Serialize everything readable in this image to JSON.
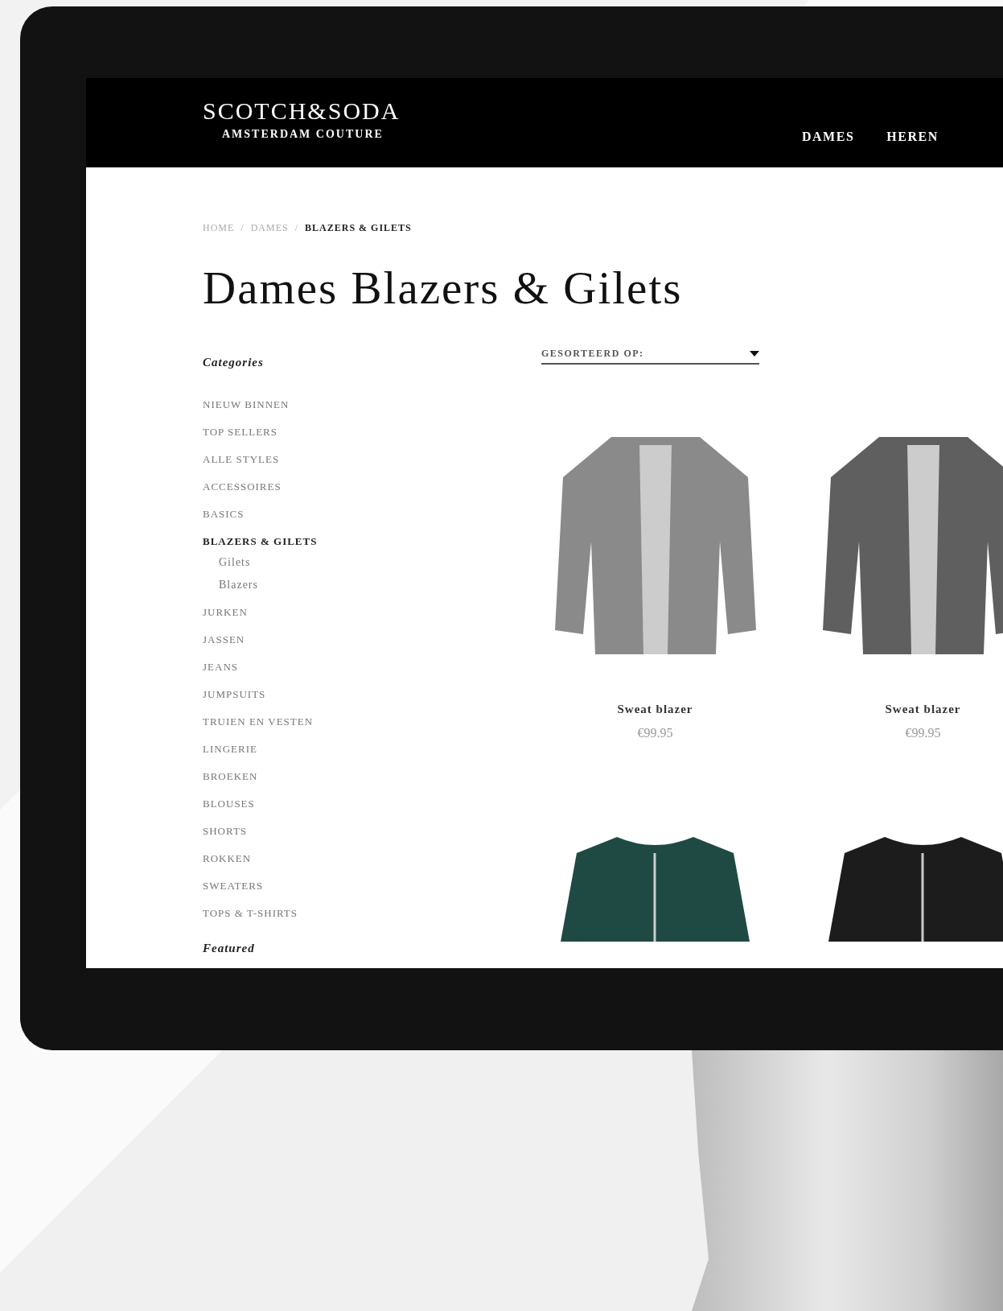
{
  "header": {
    "logo": "SCOTCH&SODA",
    "tagline": "AMSTERDAM COUTURE",
    "nav": [
      "DAMES",
      "HEREN"
    ]
  },
  "breadcrumb_separator": "/",
  "breadcrumb": [
    {
      "label": "HOME",
      "selected": false
    },
    {
      "label": "DAMES",
      "selected": false
    },
    {
      "label": "BLAZERS & GILETS",
      "selected": true
    }
  ],
  "title": "Dames Blazers & Gilets",
  "sidebar": {
    "heading": "Categories",
    "items": [
      {
        "label": "NIEUW BINNEN",
        "selected": false
      },
      {
        "label": "TOP SELLERS",
        "selected": false
      },
      {
        "label": "ALLE STYLES",
        "selected": false
      },
      {
        "label": "ACCESSOIRES",
        "selected": false
      },
      {
        "label": "BASICS",
        "selected": false
      },
      {
        "label": "BLAZERS & GILETS",
        "selected": true,
        "children": [
          {
            "label": "Gilets",
            "selected": false
          },
          {
            "label": "Blazers",
            "selected": false
          }
        ]
      },
      {
        "label": "JURKEN",
        "selected": false
      },
      {
        "label": "JASSEN",
        "selected": false
      },
      {
        "label": "JEANS",
        "selected": false
      },
      {
        "label": "JUMPSUITS",
        "selected": false
      },
      {
        "label": "TRUIEN EN VESTEN",
        "selected": false
      },
      {
        "label": "LINGERIE",
        "selected": false
      },
      {
        "label": "BROEKEN",
        "selected": false
      },
      {
        "label": "BLOUSES",
        "selected": false
      },
      {
        "label": "SHORTS",
        "selected": false
      },
      {
        "label": "ROKKEN",
        "selected": false
      },
      {
        "label": "SWEATERS",
        "selected": false
      },
      {
        "label": "TOPS & T-SHIRTS",
        "selected": false
      }
    ],
    "featured_heading": "Featured"
  },
  "sort": {
    "label": "GESORTEERD OP:"
  },
  "products": [
    {
      "kind": "blazer",
      "name": "Sweat blazer",
      "price": "€99.95"
    },
    {
      "kind": "blazer",
      "name": "Sweat blazer",
      "price": "€99.95"
    },
    {
      "kind": "jacket"
    },
    {
      "kind": "jacket"
    }
  ]
}
